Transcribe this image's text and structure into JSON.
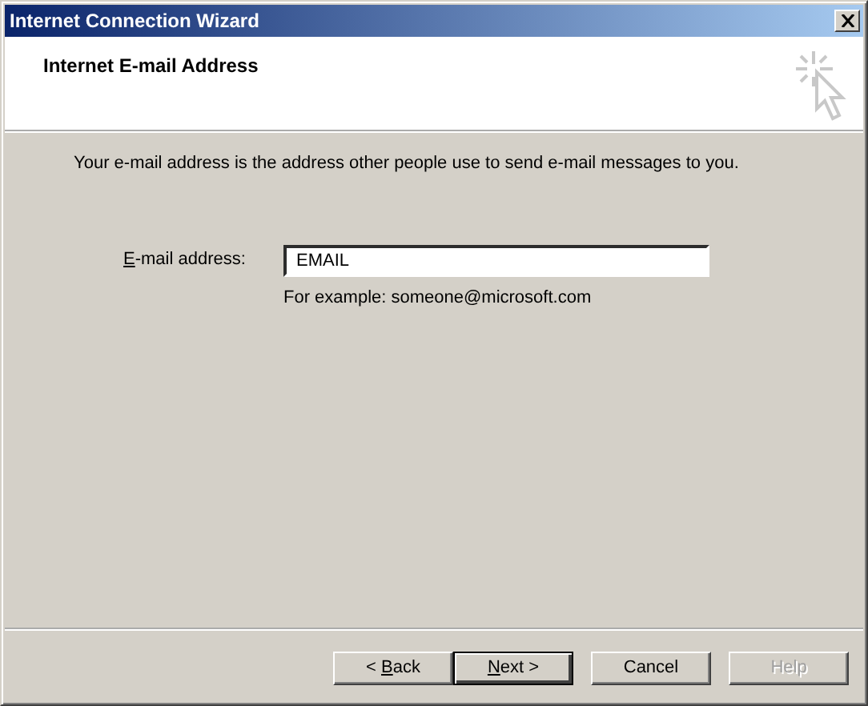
{
  "window": {
    "title": "Internet Connection Wizard"
  },
  "header": {
    "title": "Internet E-mail Address"
  },
  "intro": "Your e-mail address is the address other people use to send e-mail messages to you.",
  "field": {
    "label": {
      "key": "E",
      "after": "-mail address:"
    },
    "value": "EMAIL",
    "hint": "For example: someone@microsoft.com"
  },
  "buttons": [
    {
      "before": "< ",
      "key": "B",
      "after": "ack",
      "default": false,
      "disabled": false
    },
    {
      "key": "N",
      "after": "ext >",
      "default": true,
      "disabled": false
    },
    {
      "after": "Cancel",
      "default": false,
      "disabled": false
    },
    {
      "after": "Help",
      "default": false,
      "disabled": true
    }
  ]
}
